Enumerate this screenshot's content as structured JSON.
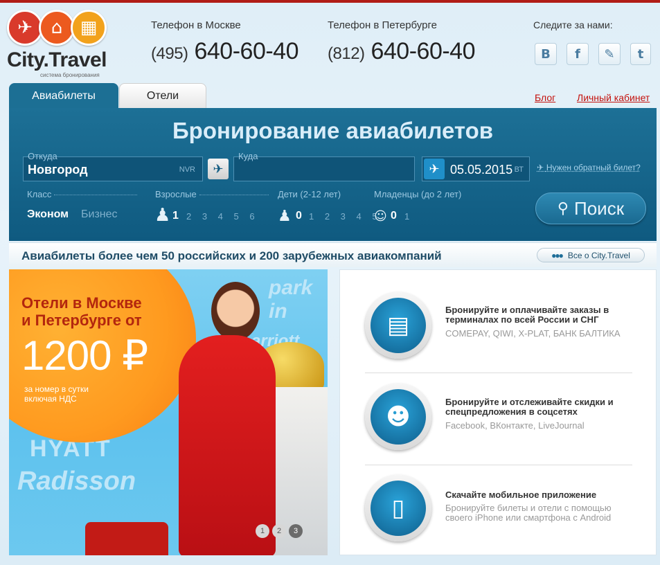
{
  "logo": {
    "name": "City.Travel",
    "tagline": "система бронирования"
  },
  "phones": [
    {
      "label": "Телефон в Москве",
      "code": "(495)",
      "number": "640-60-40"
    },
    {
      "label": "Телефон в Петербурге",
      "code": "(812)",
      "number": "640-60-40"
    }
  ],
  "social": {
    "label": "Следите за нами:",
    "items": [
      "vkontakte-icon",
      "facebook-icon",
      "livejournal-icon",
      "twitter-icon"
    ]
  },
  "tabs": [
    {
      "label": "Авиабилеты",
      "active": true
    },
    {
      "label": "Отели",
      "active": false
    }
  ],
  "top_links": {
    "blog": "Блог",
    "cabinet": "Личный кабинет"
  },
  "search": {
    "title": "Бронирование авиабилетов",
    "from_label": "Откуда",
    "from_value": "Новгород",
    "from_code": "NVR",
    "to_label": "Куда",
    "date_value": "05.05.2015",
    "date_day": "ВТ",
    "return_link": "Нужен обратный билет?",
    "class_label": "Класс",
    "class_options": [
      "Эконом",
      "Бизнес"
    ],
    "class_selected": "Эконом",
    "adults_label": "Взрослые",
    "adults_selected": "1",
    "adults_options": "2 3 4 5 6",
    "children_label": "Дети (2-12 лет)",
    "children_selected": "0",
    "children_options": "1 2 3 4 5",
    "infants_label": "Младенцы (до 2 лет)",
    "infants_selected": "0",
    "infants_options": "1",
    "button": "Поиск"
  },
  "banner": {
    "text": "Авиабилеты более чем 50 российских и 200 зарубежных авиакомпаний",
    "button": "Все о City.Travel"
  },
  "promo": {
    "headline1": "Отели в Москве",
    "headline2": "и Петербурге от",
    "price": "1200 ₽",
    "note1": "за номер в сутки",
    "note2": "включая НДС",
    "pages": [
      "1",
      "2",
      "3"
    ]
  },
  "features": [
    {
      "title": "Бронируйте и оплачивайте заказы в терминалах по всей России и СНГ",
      "sub": "COMEPAY, QIWI, X-PLAT, БАНК БАЛТИКА",
      "icon": "terminal-icon"
    },
    {
      "title": "Бронируйте и отслеживайте скидки и спецпредложения в соцсетях",
      "sub": "Facebook, ВКонтакте, LiveJournal",
      "icon": "people-icon"
    },
    {
      "title": "Скачайте мобильное приложение",
      "sub": "Бронируйте билеты и отели с помощью своего iPhone или смартфона с Android",
      "icon": "smartphone-icon"
    }
  ],
  "colors": {
    "accent": "#1c6f94",
    "red": "#c4120d",
    "orange": "#ff9a1f"
  }
}
